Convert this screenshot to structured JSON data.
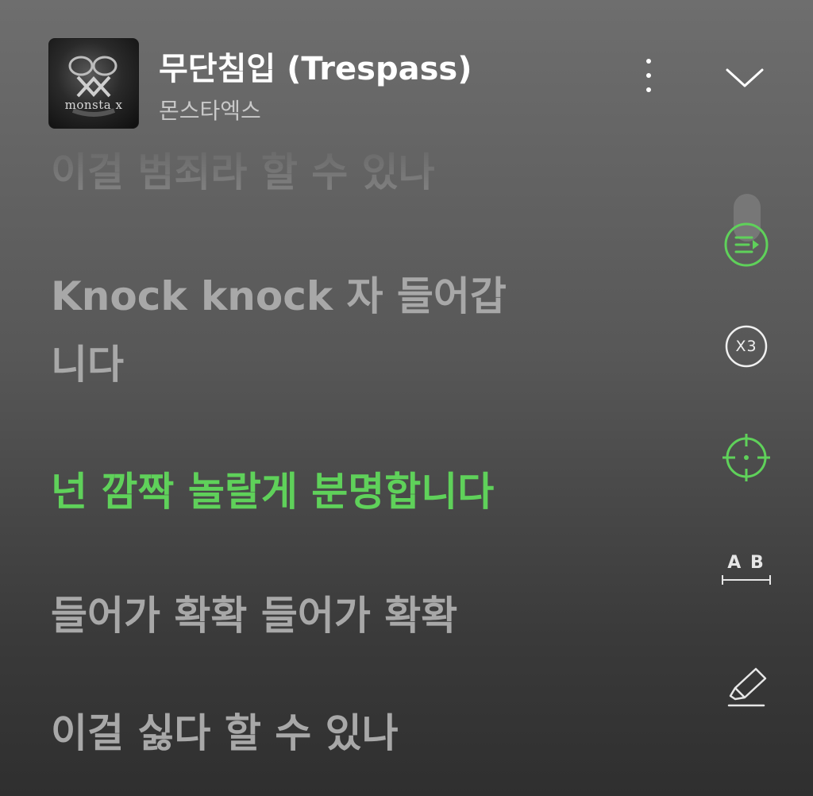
{
  "track": {
    "title": "무단침입 (Trespass)",
    "artist": "몬스타엑스",
    "cover_text": "monsta x"
  },
  "header": {
    "more_icon": "more-vertical-icon",
    "collapse_icon": "chevron-down-icon"
  },
  "lyrics": {
    "lines": [
      "이걸 범죄라 할 수 있나",
      "Knock knock 자 들어갑",
      "니다",
      "넌 깜짝 놀랄게 분명합니다",
      "들어가 확확 들어가 확확",
      "이걸 싫다 할 수 있나"
    ],
    "active_index": 3
  },
  "controls": {
    "playlist_icon": "playlist-icon",
    "repeat_label": "X3",
    "focus_icon": "crosshair-icon",
    "ab_label": "A B",
    "highlight_icon": "highlighter-icon"
  },
  "colors": {
    "accent": "#5fd15a",
    "lyric_inactive": "#a8a8a8",
    "background_top": "#6e6e6e",
    "background_bottom": "#2f2f2f"
  }
}
